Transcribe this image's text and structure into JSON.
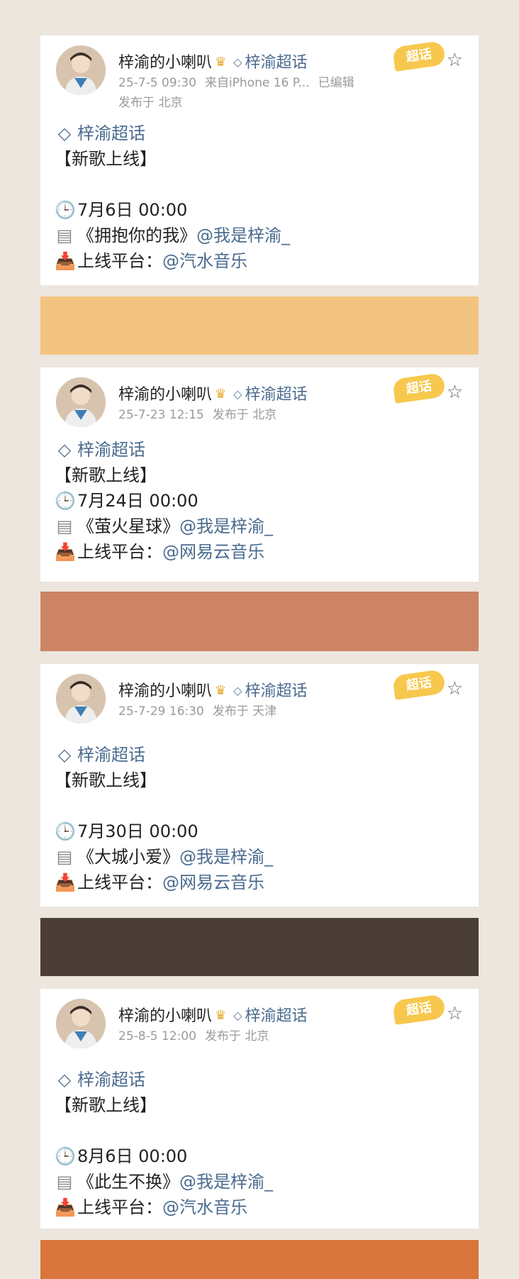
{
  "posts": [
    {
      "username": "梓渝的小喇叭",
      "topic_tag": "梓渝超话",
      "time": "25-7-5 09:30",
      "source": "来自iPhone 16 P...",
      "edited": "已编辑",
      "location": "发布于 北京",
      "badge": "超话",
      "body_topic": "梓渝超话",
      "headline": "【新歌上线】",
      "release_time": "7月6日 00:00",
      "song": "《拥抱你的我》",
      "artist_mention": "@我是梓渝_",
      "platform_label": "上线平台：",
      "platform_mention": "@汽水音乐"
    },
    {
      "username": "梓渝的小喇叭",
      "topic_tag": "梓渝超话",
      "time": "25-7-23 12:15",
      "location": "发布于 北京",
      "badge": "超话",
      "body_topic": "梓渝超话",
      "headline": "【新歌上线】",
      "release_time": "7月24日 00:00",
      "song": "《萤火星球》",
      "artist_mention": "@我是梓渝_",
      "platform_label": "上线平台：",
      "platform_mention": "@网易云音乐"
    },
    {
      "username": "梓渝的小喇叭",
      "topic_tag": "梓渝超话",
      "time": "25-7-29 16:30",
      "location": "发布于 天津",
      "badge": "超话",
      "body_topic": "梓渝超话",
      "headline": "【新歌上线】",
      "release_time": "7月30日 00:00",
      "song": "《大城小爱》",
      "artist_mention": "@我是梓渝_",
      "platform_label": "上线平台：",
      "platform_mention": "@网易云音乐"
    },
    {
      "username": "梓渝的小喇叭",
      "topic_tag": "梓渝超话",
      "time": "25-8-5 12:00",
      "location": "发布于 北京",
      "badge": "超话",
      "body_topic": "梓渝超话",
      "headline": "【新歌上线】",
      "release_time": "8月6日 00:00",
      "song": "《此生不换》",
      "artist_mention": "@我是梓渝_",
      "platform_label": "上线平台：",
      "platform_mention": "@汽水音乐"
    }
  ],
  "swatch_colors": [
    "#f3c47f",
    "#cd8464",
    "#4b3e37",
    "#d8763b"
  ],
  "icons": {
    "crown": "crown-icon",
    "gem": "gem-icon",
    "star": "star-icon",
    "clock": "clock-icon",
    "memo": "memo-icon",
    "inbox": "inbox-icon"
  }
}
